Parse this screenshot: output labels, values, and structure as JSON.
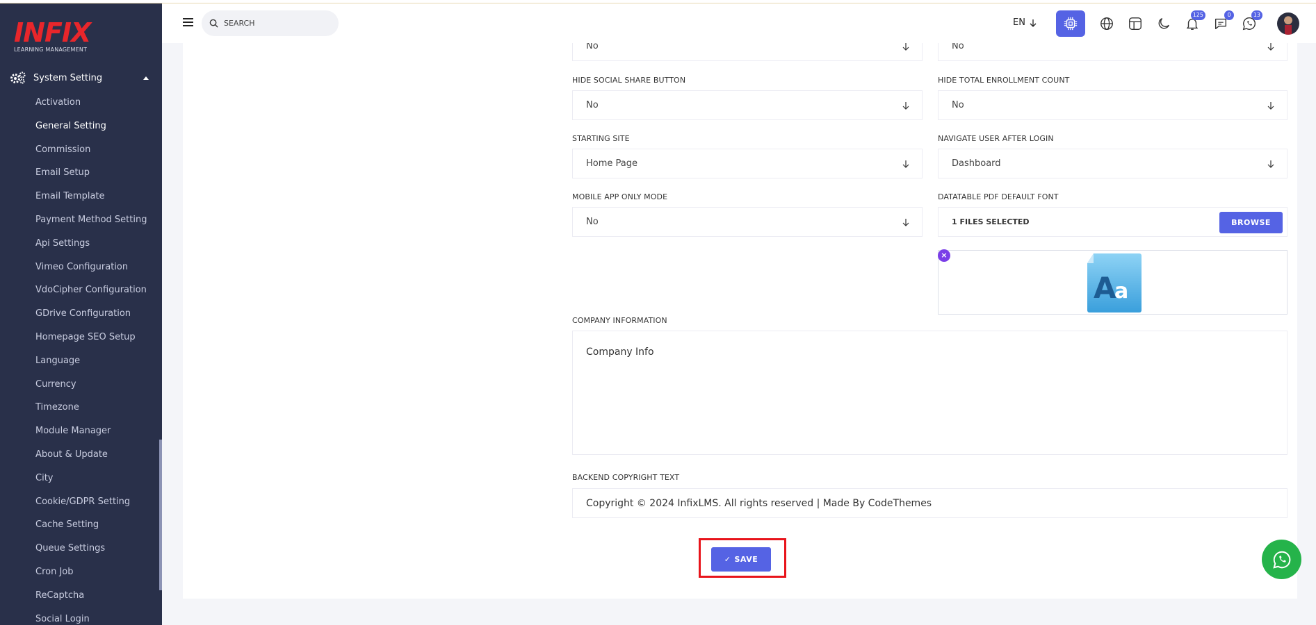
{
  "logo": {
    "brand": "INFIX",
    "subtitle": "LEARNING MANAGEMENT"
  },
  "sidebar": {
    "section_label": "System Setting",
    "items": [
      {
        "label": "Activation",
        "active": false
      },
      {
        "label": "General Setting",
        "active": true
      },
      {
        "label": "Commission",
        "active": false
      },
      {
        "label": "Email Setup",
        "active": false
      },
      {
        "label": "Email Template",
        "active": false
      },
      {
        "label": "Payment Method Setting",
        "active": false
      },
      {
        "label": "Api Settings",
        "active": false
      },
      {
        "label": "Vimeo Configuration",
        "active": false
      },
      {
        "label": "VdoCipher Configuration",
        "active": false
      },
      {
        "label": "GDrive Configuration",
        "active": false
      },
      {
        "label": "Homepage SEO Setup",
        "active": false
      },
      {
        "label": "Language",
        "active": false
      },
      {
        "label": "Currency",
        "active": false
      },
      {
        "label": "Timezone",
        "active": false
      },
      {
        "label": "Module Manager",
        "active": false
      },
      {
        "label": "About & Update",
        "active": false
      },
      {
        "label": "City",
        "active": false
      },
      {
        "label": "Cookie/GDPR Setting",
        "active": false
      },
      {
        "label": "Cache Setting",
        "active": false
      },
      {
        "label": "Queue Settings",
        "active": false
      },
      {
        "label": "Cron Job",
        "active": false
      },
      {
        "label": "ReCaptcha",
        "active": false
      },
      {
        "label": "Social Login",
        "active": false
      }
    ]
  },
  "header": {
    "search_placeholder": "SEARCH",
    "language": "EN",
    "notifications_count": "125",
    "messages_count": "0",
    "whatsapp_count": "13"
  },
  "form": {
    "top_left_value": "No",
    "top_right_value": "No",
    "hide_social_share": {
      "label": "HIDE SOCIAL SHARE BUTTON",
      "value": "No"
    },
    "hide_total_enrollment": {
      "label": "HIDE TOTAL ENROLLMENT COUNT",
      "value": "No"
    },
    "starting_site": {
      "label": "STARTING SITE",
      "value": "Home Page"
    },
    "navigate_after_login": {
      "label": "NAVIGATE USER AFTER LOGIN",
      "value": "Dashboard"
    },
    "mobile_app_only": {
      "label": "MOBILE APP ONLY MODE",
      "value": "No"
    },
    "datatable_pdf_font": {
      "label": "DATATABLE PDF DEFAULT FONT",
      "value": "1 FILES SELECTED",
      "browse_label": "BROWSE"
    },
    "company_info": {
      "label": "COMPANY INFORMATION",
      "value": "Company Info"
    },
    "backend_copyright": {
      "label": "BACKEND COPYRIGHT TEXT",
      "value": "Copyright © 2024 InfixLMS. All rights reserved | Made By CodeThemes"
    },
    "save_label": "SAVE"
  },
  "colors": {
    "sidebar_bg": "#29304a",
    "primary": "#5563e4",
    "highlight": "#e8141b",
    "whatsapp": "#25b34a",
    "logo_red": "#e8262b"
  }
}
